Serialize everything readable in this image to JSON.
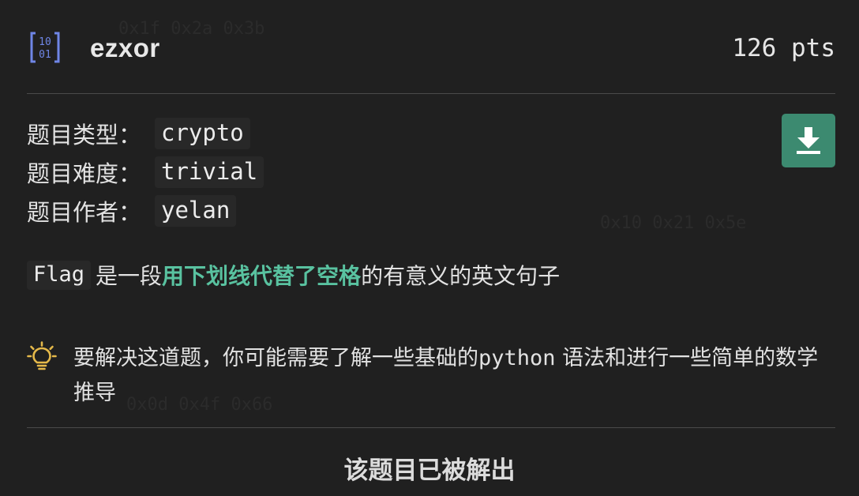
{
  "challenge": {
    "title": "ezxor",
    "points": "126 pts",
    "icon": "binary-icon"
  },
  "meta": [
    {
      "label": "题目类型：",
      "value": "crypto"
    },
    {
      "label": "题目难度：",
      "value": "trivial"
    },
    {
      "label": "题目作者：",
      "value": "yelan"
    }
  ],
  "actions": {
    "download_icon": "download-icon"
  },
  "description": {
    "code_term": "Flag",
    "text_before": " 是一段",
    "highlight": "用下划线代替了空格",
    "text_after": "的有意义的英文句子"
  },
  "hint": {
    "icon": "lightbulb-icon",
    "text_before": "要解决这道题，你可能需要了解一些基础的",
    "code_term": "python",
    "text_after": " 语法和进行一些简单的数学推导"
  },
  "status": {
    "label": "该题目已被解出"
  },
  "colors": {
    "accent": "#59c2a0",
    "button": "#3c8a70",
    "icon_blue": "#6f86e6",
    "bulb": "#e5b94a",
    "background": "#202020"
  }
}
